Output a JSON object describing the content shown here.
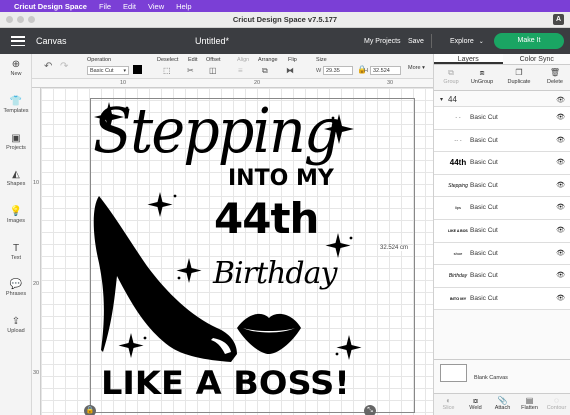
{
  "menubar": {
    "app_name": "Cricut Design Space",
    "items": [
      "File",
      "Edit",
      "View",
      "Help"
    ]
  },
  "window": {
    "title": "Cricut Design Space  v7.5.177"
  },
  "appbar": {
    "canvas_label": "Canvas",
    "document_title": "Untitled*",
    "my_projects": "My Projects",
    "save": "Save",
    "explore": "Explore",
    "make_it": "Make It",
    "accent_color": "#1aa563"
  },
  "toolbar": {
    "operation_label": "Operation",
    "operation_value": "Basic Cut",
    "deselect": "Deselect",
    "edit": "Edit",
    "offset": "Offset",
    "align": "Align",
    "arrange": "Arrange",
    "flip": "Flip",
    "size": "Size",
    "width_label": "W",
    "width_value": "29.35",
    "height_label": "H",
    "height_value": "32.524",
    "more": "More"
  },
  "leftbar": {
    "items": [
      {
        "label": "New",
        "icon": "plus-icon"
      },
      {
        "label": "Templates",
        "icon": "shirt-icon"
      },
      {
        "label": "Projects",
        "icon": "projects-icon"
      },
      {
        "label": "Shapes",
        "icon": "shapes-icon"
      },
      {
        "label": "Images",
        "icon": "bulb-icon"
      },
      {
        "label": "Text",
        "icon": "text-icon"
      },
      {
        "label": "Phrases",
        "icon": "speech-bubble-icon"
      },
      {
        "label": "Upload",
        "icon": "upload-icon"
      }
    ]
  },
  "rulers": {
    "top": [
      "10",
      "20",
      "30"
    ],
    "left": [
      "10",
      "20",
      "30"
    ]
  },
  "canvas": {
    "dimension_label": "32.524 cm",
    "design": {
      "line1": "Stepping",
      "line2": "INTO MY",
      "line3": "44th",
      "line4": "Birthday",
      "line5": "LIKE A BOSS!"
    }
  },
  "rightpanel": {
    "tabs": [
      "Layers",
      "Color Sync"
    ],
    "actions": [
      "Group",
      "UnGroup",
      "Duplicate",
      "Delete"
    ],
    "group_name": "44",
    "layers": [
      {
        "thumb": "· ·",
        "name": "Basic Cut"
      },
      {
        "thumb": "·· ·",
        "name": "Basic Cut"
      },
      {
        "thumb": "44th",
        "name": "Basic Cut"
      },
      {
        "thumb": "Stepping",
        "name": "Basic Cut"
      },
      {
        "thumb": "lips",
        "name": "Basic Cut"
      },
      {
        "thumb": "LIKE A BOSS",
        "name": "Basic Cut"
      },
      {
        "thumb": "shoe",
        "name": "Basic Cut"
      },
      {
        "thumb": "Birthday",
        "name": "Basic Cut"
      },
      {
        "thumb": "INTO MY",
        "name": "Basic Cut"
      }
    ],
    "blank_canvas": "Blank Canvas",
    "bottom_actions": [
      "Slice",
      "Weld",
      "Attach",
      "Flatten",
      "Contour"
    ]
  }
}
